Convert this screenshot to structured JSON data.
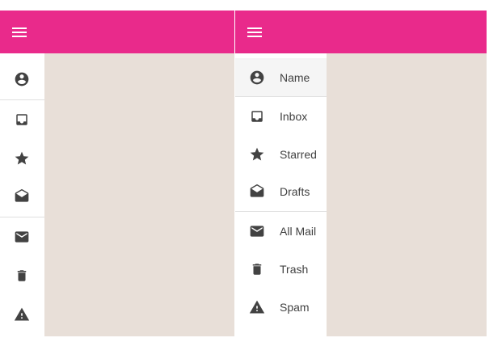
{
  "colors": {
    "appbar": "#e92a8b",
    "content_bg": "#e8dfd8",
    "drawer_bg": "#ffffff",
    "icon": "#424242",
    "selected_bg": "#f5f5f5",
    "divider": "#e0e0e0"
  },
  "collapsed_panel": {
    "menu_icon": "menu-icon",
    "items": [
      {
        "icon": "account-circle-icon"
      },
      {
        "icon": "inbox-icon"
      },
      {
        "icon": "star-icon"
      },
      {
        "icon": "drafts-icon"
      },
      {
        "icon": "mail-icon"
      },
      {
        "icon": "delete-icon"
      },
      {
        "icon": "warning-icon"
      }
    ]
  },
  "expanded_panel": {
    "menu_icon": "menu-icon",
    "items": [
      {
        "icon": "account-circle-icon",
        "label": "Name",
        "selected": true
      },
      {
        "icon": "inbox-icon",
        "label": "Inbox"
      },
      {
        "icon": "star-icon",
        "label": "Starred"
      },
      {
        "icon": "drafts-icon",
        "label": "Drafts"
      },
      {
        "icon": "mail-icon",
        "label": "All Mail"
      },
      {
        "icon": "delete-icon",
        "label": "Trash"
      },
      {
        "icon": "warning-icon",
        "label": "Spam"
      }
    ]
  }
}
